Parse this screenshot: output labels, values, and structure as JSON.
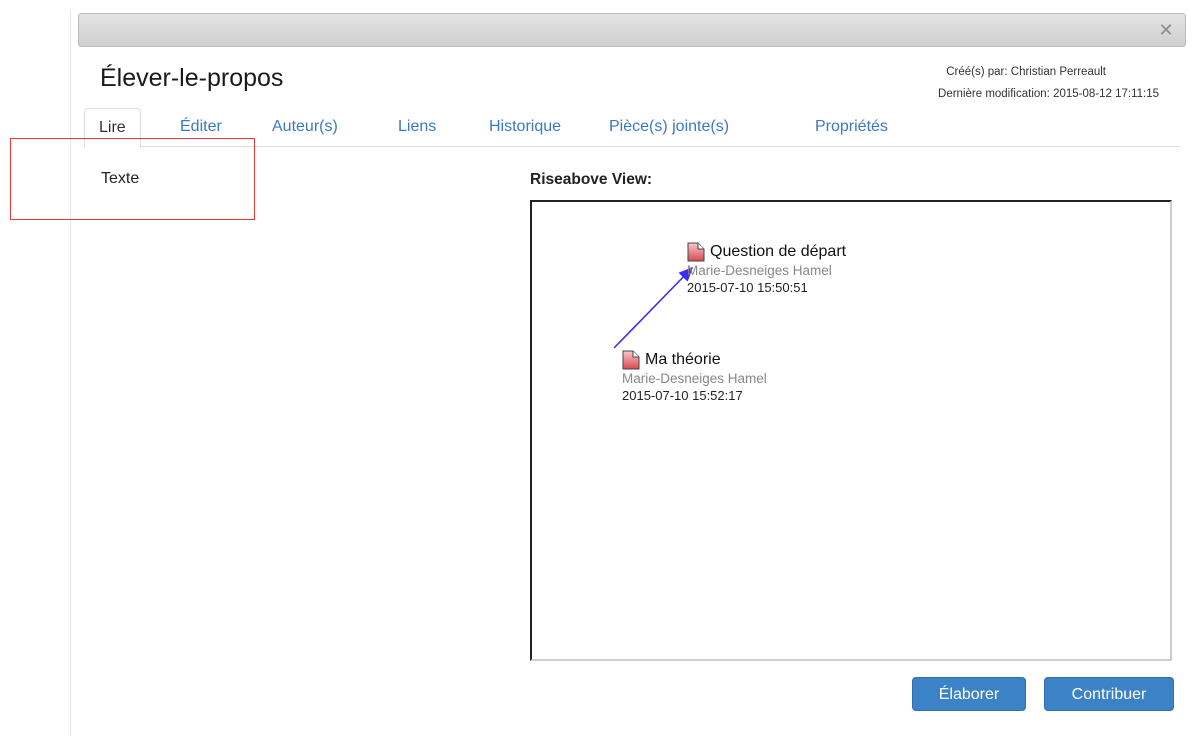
{
  "dialog": {
    "close_icon": "close-icon"
  },
  "note": {
    "title": "Élever-le-propos",
    "created_by": "Créé(s) par: Christian Perreault",
    "last_modified": "Dernière modification: 2015-08-12 17:11:15"
  },
  "tabs": [
    {
      "label": "Lire",
      "active": true
    },
    {
      "label": "Éditer",
      "active": false
    },
    {
      "label": "Auteur(s)",
      "active": false
    },
    {
      "label": "Liens",
      "active": false
    },
    {
      "label": "Historique",
      "active": false
    },
    {
      "label": "Pièce(s) jointe(s)",
      "active": false
    },
    {
      "label": "Propriétés",
      "active": false
    }
  ],
  "content": {
    "text_label": "Texte"
  },
  "riseabove": {
    "label": "Riseabove View:",
    "notes": [
      {
        "title": "Question de départ",
        "author": "Marie-Desneiges Hamel",
        "date": "2015-07-10 15:50:51",
        "icon": "document-icon"
      },
      {
        "title": "Ma théorie",
        "author": "Marie-Desneiges Hamel",
        "date": "2015-07-10 15:52:17",
        "icon": "document-icon"
      }
    ]
  },
  "actions": {
    "elaborate_label": "Élaborer",
    "contribute_label": "Contribuer"
  },
  "colors": {
    "accent": "#3c82c6",
    "link": "#3c78c3",
    "highlight": "#e53935",
    "arrow": "#3a2ff0"
  }
}
